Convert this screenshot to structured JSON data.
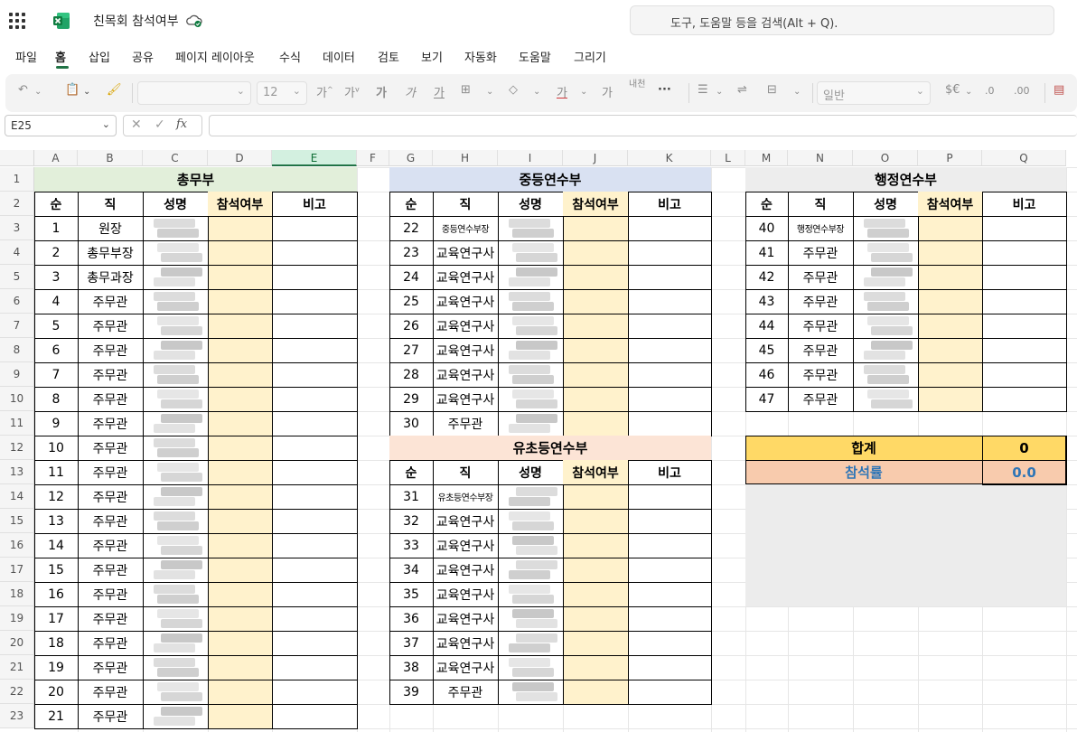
{
  "app": {
    "doc_title": "친목회 참석여부",
    "search_placeholder": "도구, 도움말 등을 검색(Alt + Q)."
  },
  "menu": [
    "파일",
    "홈",
    "삽입",
    "공유",
    "페이지 레이아웃",
    "수식",
    "데이터",
    "검토",
    "보기",
    "자동화",
    "도움말",
    "그리기"
  ],
  "menu_active": "홈",
  "ribbon": {
    "font_size": "12",
    "number_format": "일반"
  },
  "formula_bar": {
    "name_box": "E25",
    "fx_label": "fx"
  },
  "columns": [
    "A",
    "B",
    "C",
    "D",
    "E",
    "F",
    "G",
    "H",
    "I",
    "J",
    "K",
    "L",
    "M",
    "N",
    "O",
    "P",
    "Q"
  ],
  "selected_column": "E",
  "rows": [
    "1",
    "2",
    "3",
    "4",
    "5",
    "6",
    "7",
    "8",
    "9",
    "10",
    "11",
    "12",
    "13",
    "14",
    "15",
    "16",
    "17",
    "18",
    "19",
    "20",
    "21",
    "22",
    "23"
  ],
  "tables": {
    "general": {
      "title": "총무부",
      "headers": [
        "순",
        "직",
        "성명",
        "참석여부",
        "비고"
      ],
      "rows": [
        [
          "1",
          "원장"
        ],
        [
          "2",
          "총무부장"
        ],
        [
          "3",
          "총무과장"
        ],
        [
          "4",
          "주무관"
        ],
        [
          "5",
          "주무관"
        ],
        [
          "6",
          "주무관"
        ],
        [
          "7",
          "주무관"
        ],
        [
          "8",
          "주무관"
        ],
        [
          "9",
          "주무관"
        ],
        [
          "10",
          "주무관"
        ],
        [
          "11",
          "주무관"
        ],
        [
          "12",
          "주무관"
        ],
        [
          "13",
          "주무관"
        ],
        [
          "14",
          "주무관"
        ],
        [
          "15",
          "주무관"
        ],
        [
          "16",
          "주무관"
        ],
        [
          "17",
          "주무관"
        ],
        [
          "18",
          "주무관"
        ],
        [
          "19",
          "주무관"
        ],
        [
          "20",
          "주무관"
        ],
        [
          "21",
          "주무관"
        ]
      ]
    },
    "secondary": {
      "title": "중등연수부",
      "headers": [
        "순",
        "직",
        "성명",
        "참석여부",
        "비고"
      ],
      "rows": [
        [
          "22",
          "중등연수부장"
        ],
        [
          "23",
          "교육연구사"
        ],
        [
          "24",
          "교육연구사"
        ],
        [
          "25",
          "교육연구사"
        ],
        [
          "26",
          "교육연구사"
        ],
        [
          "27",
          "교육연구사"
        ],
        [
          "28",
          "교육연구사"
        ],
        [
          "29",
          "교육연구사"
        ],
        [
          "30",
          "주무관"
        ]
      ]
    },
    "elementary": {
      "title": "유초등연수부",
      "headers": [
        "순",
        "직",
        "성명",
        "참석여부",
        "비고"
      ],
      "rows": [
        [
          "31",
          "유초등연수부장"
        ],
        [
          "32",
          "교육연구사"
        ],
        [
          "33",
          "교육연구사"
        ],
        [
          "34",
          "교육연구사"
        ],
        [
          "35",
          "교육연구사"
        ],
        [
          "36",
          "교육연구사"
        ],
        [
          "37",
          "교육연구사"
        ],
        [
          "38",
          "교육연구사"
        ],
        [
          "39",
          "주무관"
        ]
      ]
    },
    "admin": {
      "title": "행정연수부",
      "headers": [
        "순",
        "직",
        "성명",
        "참석여부",
        "비고"
      ],
      "rows": [
        [
          "40",
          "행정연수부장"
        ],
        [
          "41",
          "주무관"
        ],
        [
          "42",
          "주무관"
        ],
        [
          "43",
          "주무관"
        ],
        [
          "44",
          "주무관"
        ],
        [
          "45",
          "주무관"
        ],
        [
          "46",
          "주무관"
        ],
        [
          "47",
          "주무관"
        ]
      ]
    }
  },
  "summary": {
    "total_label": "합계",
    "total_value": "0",
    "rate_label": "참석률",
    "rate_value": "0.0"
  },
  "colors": {
    "accent": "#217346",
    "green_header": "#e2efda",
    "blue_header": "#d9e1f2",
    "orange_header": "#fce4d6",
    "gray_header": "#ededed",
    "attendance_fill": "#fff2cc",
    "total_fill": "#ffd966",
    "rate_fill": "#f8cbad",
    "rate_text": "#2e75b6",
    "merged_gray": "#ececec"
  }
}
